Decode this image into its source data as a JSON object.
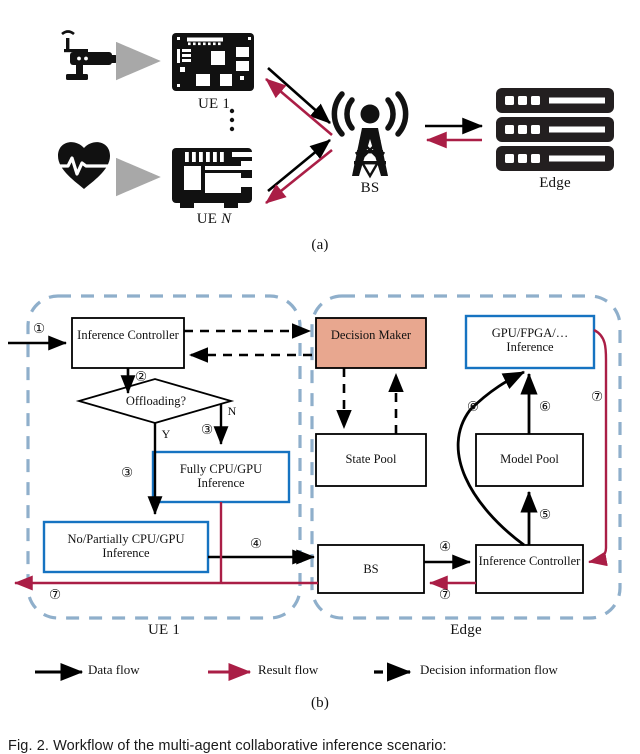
{
  "figure": {
    "caption": "Fig. 2. Workflow of the multi-agent collaborative inference scenario:",
    "panel_a_label": "(a)",
    "panel_b_label": "(b)"
  },
  "colors": {
    "data_flow": "#000000",
    "result_flow": "#AA1E46",
    "decision_flow": "#000000",
    "container_dashed": "#8FAFCB",
    "highlight_box_border": "#1673C1",
    "decision_maker_fill": "#E8A78F",
    "icon_fill": "#111111",
    "gray_arrow": "#A8A8A8"
  },
  "panel_a": {
    "devices": [
      {
        "icon": "security-camera-icon",
        "board_icon": "single-board-computer-icon",
        "label": "UE 1",
        "label_italic": ""
      },
      {
        "icon": "heartbeat-monitor-icon",
        "board_icon": "embedded-module-icon",
        "label": "UE ",
        "label_italic": "N"
      }
    ],
    "vertical_dots": "⋮",
    "base_station": {
      "icon": "base-station-tower-icon",
      "label": "BS"
    },
    "edge": {
      "icon": "server-rack-icon",
      "label": "Edge"
    }
  },
  "panel_b": {
    "ue_container": {
      "label": "UE 1",
      "nodes": [
        {
          "id": "ue-inference-controller",
          "label": "Inference Controller",
          "style": "plain"
        },
        {
          "id": "offloading-decision",
          "label": "Offloading?",
          "style": "diamond"
        },
        {
          "id": "fully-cpu-gpu-inference",
          "label": "Fully CPU/GPU Inference",
          "style": "highlight"
        },
        {
          "id": "no-partially-cpu-gpu-inference",
          "label": "No/Partially CPU/GPU Inference",
          "style": "highlight"
        }
      ],
      "branch_yes": "Y",
      "branch_no": "N"
    },
    "edge_container": {
      "label": "Edge",
      "nodes": [
        {
          "id": "decision-maker",
          "label": "Decision Maker",
          "style": "filled"
        },
        {
          "id": "state-pool",
          "label": "State Pool",
          "style": "plain"
        },
        {
          "id": "gpu-fpga-inference",
          "label": "GPU/FPGA/… Inference",
          "style": "highlight"
        },
        {
          "id": "model-pool",
          "label": "Model Pool",
          "style": "plain"
        },
        {
          "id": "bs",
          "label": "BS",
          "style": "plain"
        },
        {
          "id": "edge-inference-controller",
          "label": "Inference Controller",
          "style": "plain"
        }
      ]
    },
    "step_markers": {
      "s1": "①",
      "s2": "②",
      "s3a": "③",
      "s3b": "③",
      "s4a": "④",
      "s4b": "④",
      "s5": "⑤",
      "s6a": "⑥",
      "s6b": "⑥",
      "s7a": "⑦",
      "s7b": "⑦",
      "s7c": "⑦"
    }
  },
  "legend": {
    "items": [
      {
        "key": "data-flow",
        "label": "Data flow",
        "style": "solid",
        "color": "#000000"
      },
      {
        "key": "result-flow",
        "label": "Result flow",
        "style": "solid",
        "color": "#AA1E46"
      },
      {
        "key": "decision-information-flow",
        "label": "Decision information flow",
        "style": "dashed",
        "color": "#000000"
      }
    ]
  }
}
